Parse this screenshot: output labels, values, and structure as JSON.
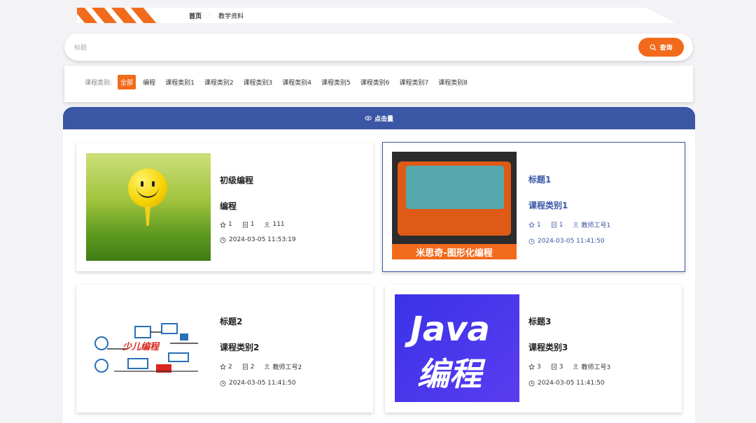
{
  "breadcrumb": {
    "home": "首页",
    "current": "教学资料"
  },
  "search": {
    "placeholder": "标题",
    "button_label": "查询"
  },
  "filter": {
    "label": "课程类别:",
    "options": [
      "全部",
      "编程",
      "课程类别1",
      "课程类别2",
      "课程类别3",
      "课程类别4",
      "课程类别5",
      "课程类别6",
      "课程类别7",
      "课程类别8"
    ]
  },
  "panel": {
    "header": "点击量"
  },
  "cards": [
    {
      "title": "初级编程",
      "category": "编程",
      "stars": "1",
      "views": "1",
      "author": "111",
      "time": "2024-03-05 11:53:19",
      "thumb": "golf-ball-image"
    },
    {
      "title": "标题1",
      "category": "课程类别1",
      "stars": "1",
      "views": "1",
      "author": "教师工号1",
      "time": "2024-03-05 11:41:50",
      "thumb": "kit-image",
      "banner": "米思奇-图形化编程"
    },
    {
      "title": "标题2",
      "category": "课程类别2",
      "stars": "2",
      "views": "2",
      "author": "教师工号2",
      "time": "2024-03-05 11:41:50",
      "thumb": "kids-coding-image",
      "banner": "少儿编程"
    },
    {
      "title": "标题3",
      "category": "课程类别3",
      "stars": "3",
      "views": "3",
      "author": "教师工号3",
      "time": "2024-03-05 11:41:50",
      "thumb": "java-image",
      "banner_1": "Java",
      "banner_2": "编程"
    }
  ],
  "colors": {
    "accent": "#f26b1d",
    "primary": "#3a56a5"
  }
}
